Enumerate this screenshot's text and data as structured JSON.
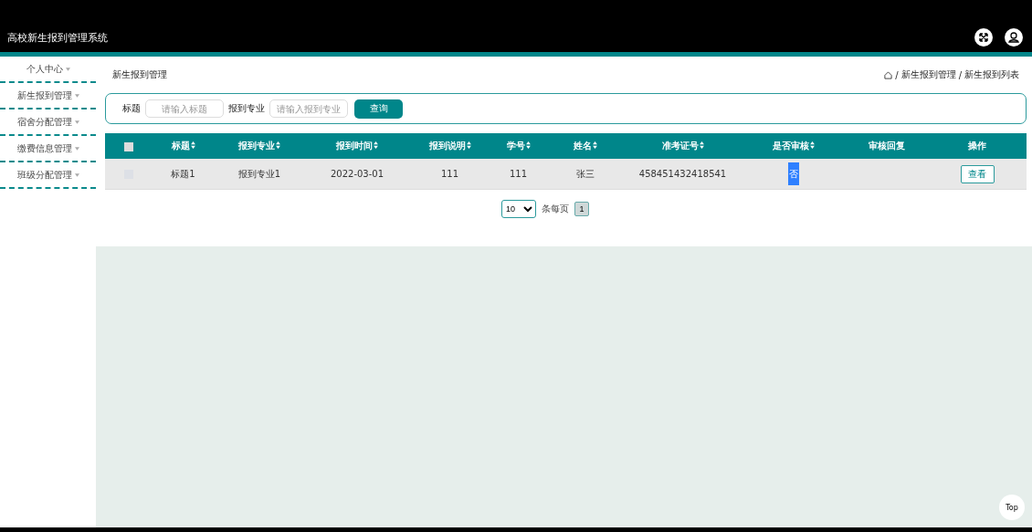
{
  "header": {
    "title": "高校新生报到管理系统"
  },
  "sidebar": {
    "items": [
      {
        "label": "个人中心",
        "selected": false
      },
      {
        "label": "新生报到管理",
        "selected": false
      },
      {
        "label": "宿舍分配管理",
        "selected": false
      },
      {
        "label": "缴费信息管理",
        "selected": false
      },
      {
        "label": "班级分配管理",
        "selected": false
      }
    ]
  },
  "page_title": "新生报到管理",
  "breadcrumb": [
    {
      "separator": "/",
      "label": "新生报到管理"
    },
    {
      "separator": "/",
      "label": "新生报到列表"
    }
  ],
  "search": {
    "fields": [
      {
        "label": "标题",
        "placeholder": "请输入标题"
      },
      {
        "label": "报到专业",
        "placeholder": "请输入报到专业"
      }
    ],
    "button": "查询"
  },
  "table": {
    "select_all_checked": false,
    "columns": [
      {
        "label": "标题",
        "sortable": true
      },
      {
        "label": "报到专业",
        "sortable": true
      },
      {
        "label": "报到时间",
        "sortable": true
      },
      {
        "label": "报到说明",
        "sortable": true
      },
      {
        "label": "学号",
        "sortable": true
      },
      {
        "label": "姓名",
        "sortable": true
      },
      {
        "label": "准考证号",
        "sortable": true
      },
      {
        "label": "是否审核",
        "sortable": true
      },
      {
        "label": "审核回复",
        "sortable": false
      },
      {
        "label": "操作",
        "sortable": false
      }
    ],
    "rows": [
      {
        "checked": false,
        "cells": [
          "标题1",
          "报到专业1",
          "2022-03-01",
          "111",
          "111",
          "张三",
          "458451432418541"
        ],
        "review": {
          "text": "否",
          "selected": true
        },
        "action": "查看"
      }
    ]
  },
  "pagination": {
    "page_size": "10",
    "per_page_label": "条每页",
    "pages": [
      {
        "label": "1",
        "selected": true
      }
    ]
  },
  "top_button": "Top"
}
